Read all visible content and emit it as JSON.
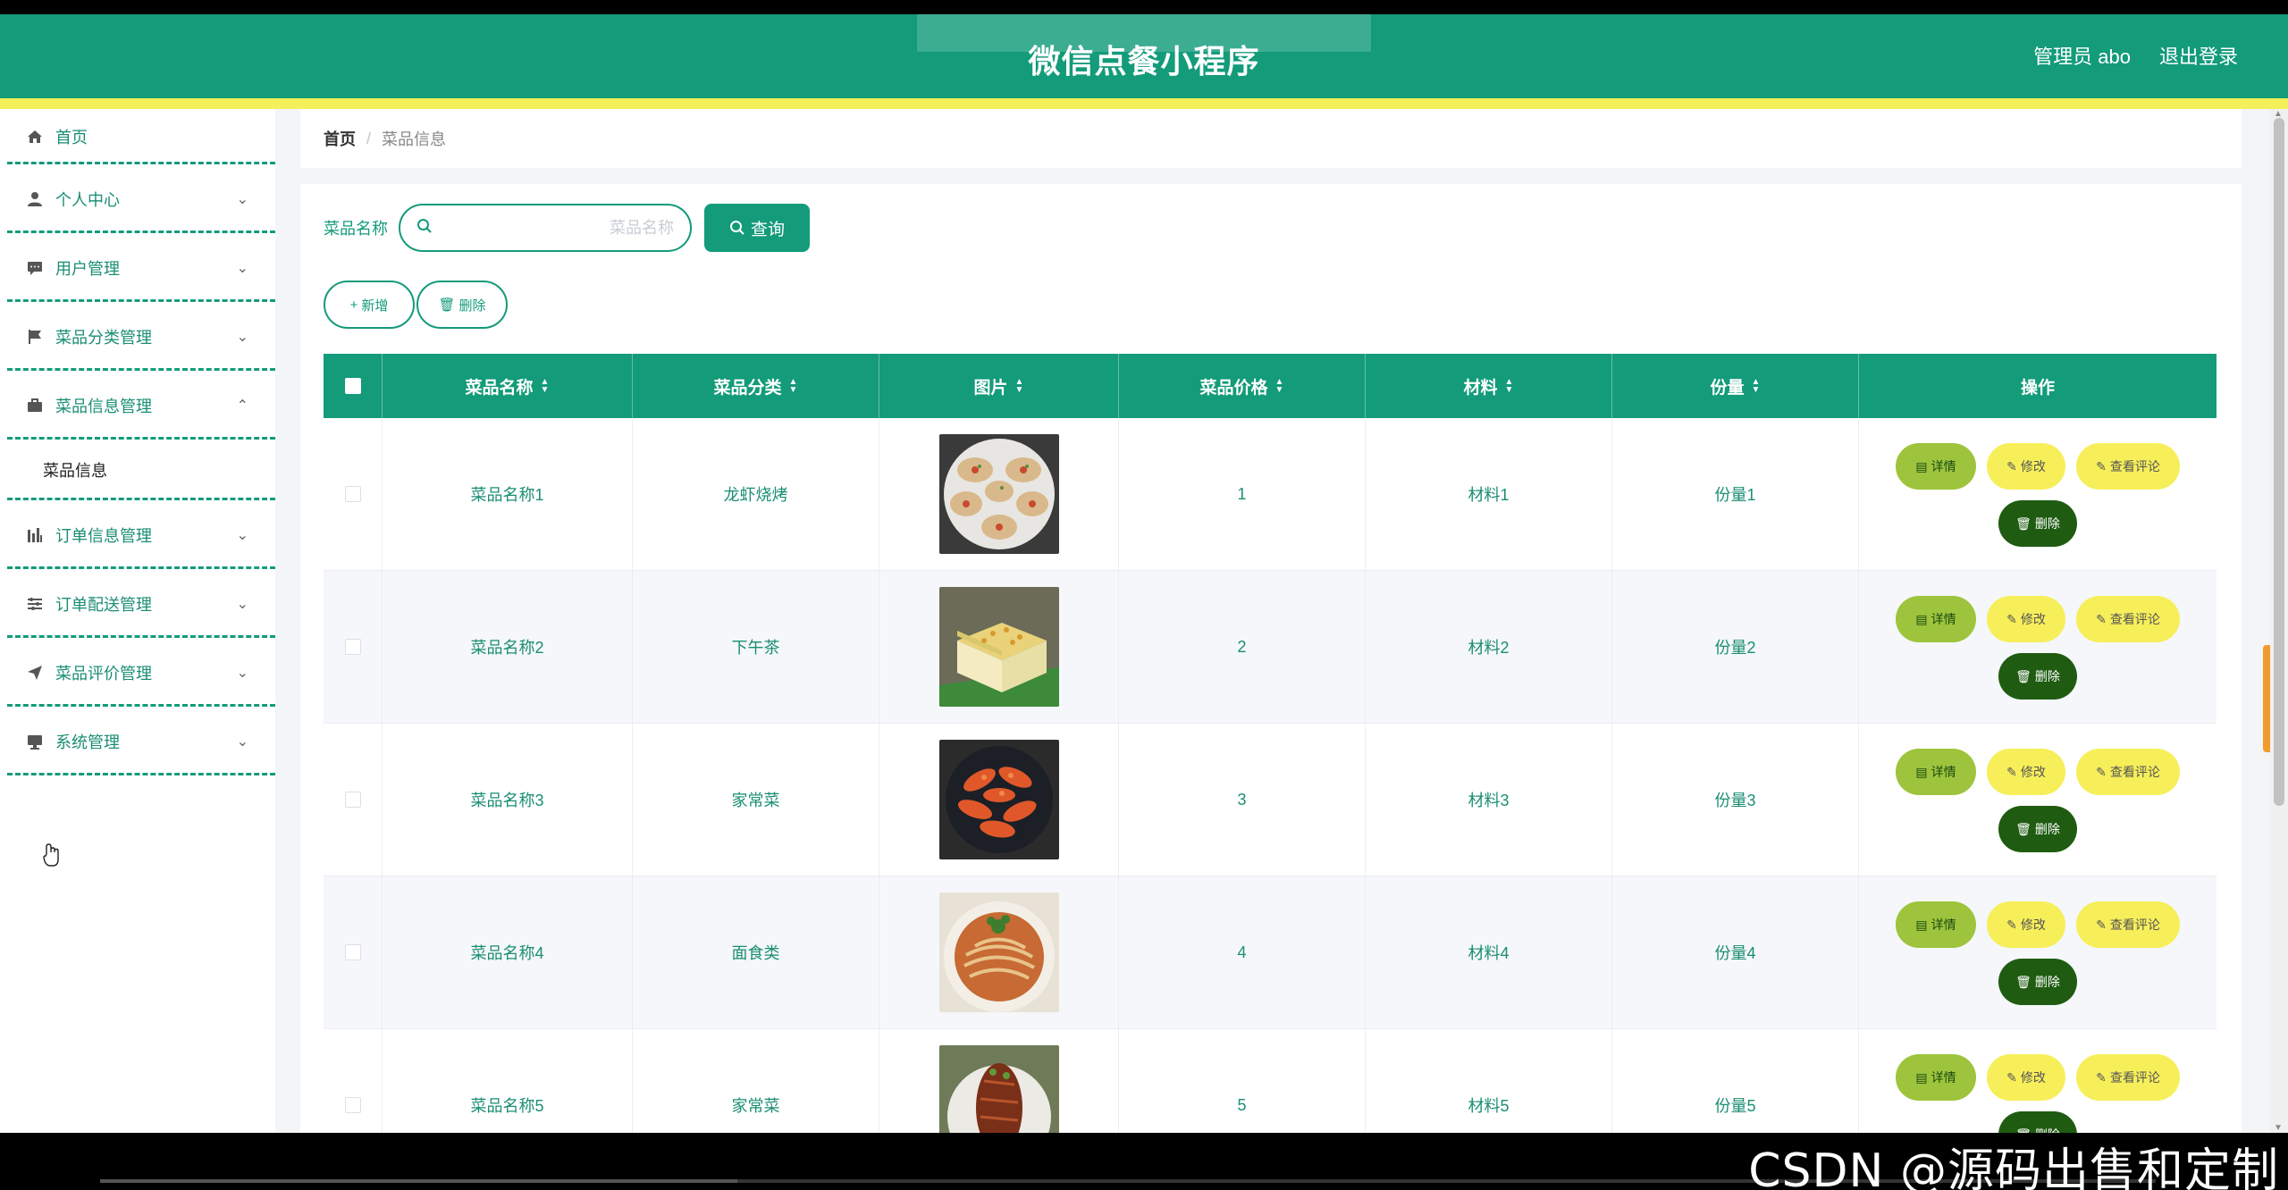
{
  "header": {
    "title": "微信点餐小程序",
    "admin": "管理员 abo",
    "logout": "退出登录"
  },
  "sidebar": {
    "items": [
      {
        "label": "首页",
        "icon": "home-icon",
        "chevron": false
      },
      {
        "label": "个人中心",
        "icon": "user-icon",
        "chevron": true
      },
      {
        "label": "用户管理",
        "icon": "chat-icon",
        "chevron": true
      },
      {
        "label": "菜品分类管理",
        "icon": "flag-icon",
        "chevron": true
      },
      {
        "label": "菜品信息管理",
        "icon": "briefcase-icon",
        "chevron": true,
        "expanded": true
      },
      {
        "label": "订单信息管理",
        "icon": "bar-chart-icon",
        "chevron": true
      },
      {
        "label": "订单配送管理",
        "icon": "sliders-icon",
        "chevron": true
      },
      {
        "label": "菜品评价管理",
        "icon": "send-icon",
        "chevron": true
      },
      {
        "label": "系统管理",
        "icon": "monitor-icon",
        "chevron": true
      }
    ],
    "submenu": "菜品信息"
  },
  "breadcrumb": {
    "home": "首页",
    "sep": "/",
    "current": "菜品信息"
  },
  "search": {
    "label": "菜品名称",
    "placeholder": "菜品名称",
    "button": "查询"
  },
  "actions": {
    "add": "新增",
    "delete": "删除"
  },
  "table": {
    "headers": {
      "name": "菜品名称",
      "category": "菜品分类",
      "image": "图片",
      "price": "菜品价格",
      "material": "材料",
      "quantity": "份量",
      "ops": "操作"
    },
    "rows": [
      {
        "name": "菜品名称1",
        "category": "龙虾烧烤",
        "price": "1",
        "material": "材料1",
        "quantity": "份量1"
      },
      {
        "name": "菜品名称2",
        "category": "下午茶",
        "price": "2",
        "material": "材料2",
        "quantity": "份量2"
      },
      {
        "name": "菜品名称3",
        "category": "家常菜",
        "price": "3",
        "material": "材料3",
        "quantity": "份量3"
      },
      {
        "name": "菜品名称4",
        "category": "面食类",
        "price": "4",
        "material": "材料4",
        "quantity": "份量4"
      },
      {
        "name": "菜品名称5",
        "category": "家常菜",
        "price": "5",
        "material": "材料5",
        "quantity": "份量5"
      }
    ],
    "op_labels": {
      "detail": "详情",
      "edit": "修改",
      "review": "查看评论",
      "delete": "删除"
    }
  },
  "video": {
    "progress_percent": 31
  },
  "watermark": "CSDN @源码出售和定制",
  "colors": {
    "primary": "#139b7a",
    "accent_yellow": "#f3f05a",
    "detail_green": "#9dc43c",
    "delete_dark": "#1f5c12"
  }
}
